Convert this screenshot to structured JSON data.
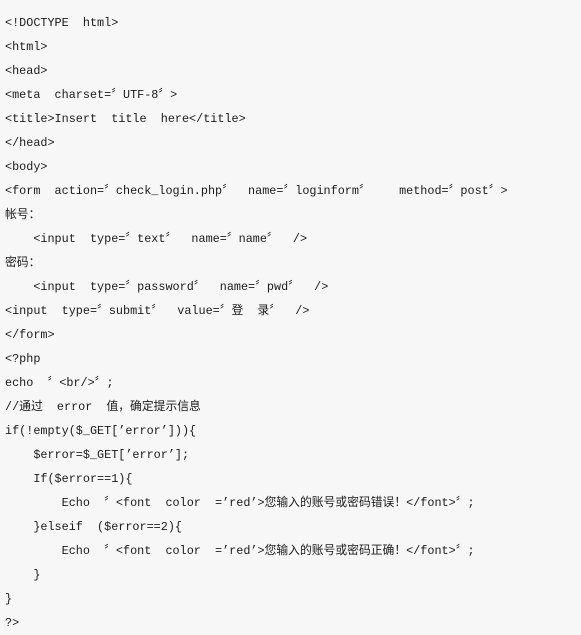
{
  "document": {
    "kind": "source-code-listing",
    "language": "php-html",
    "background_color": "#f7f7f7",
    "text_color": "#1a1a1a",
    "line_count": 24,
    "lines": [
      {
        "n": 1,
        "text": "<!DOCTYPE  html>"
      },
      {
        "n": 2,
        "text": "<html>"
      },
      {
        "n": 3,
        "text": "<head>"
      },
      {
        "n": 4,
        "text": "<meta  charset=〞UTF-8〞>"
      },
      {
        "n": 5,
        "text": "<title>Insert  title  here</title>"
      },
      {
        "n": 6,
        "text": "</head>"
      },
      {
        "n": 7,
        "text": "<body>"
      },
      {
        "n": 8,
        "text": "<form  action=〞check_login.php〞  name=〞loginform〞    method=〞post〞>"
      },
      {
        "n": 9,
        "text": "帐号："
      },
      {
        "n": 10,
        "text": "    <input  type=〞text〞  name=〞name〞  />"
      },
      {
        "n": 11,
        "text": "密码："
      },
      {
        "n": 12,
        "text": "    <input  type=〞password〞  name=〞pwd〞  />"
      },
      {
        "n": 13,
        "text": "<input  type=〞submit〞  value=〞登  录〞  />"
      },
      {
        "n": 14,
        "text": "</form>"
      },
      {
        "n": 15,
        "text": "<?php"
      },
      {
        "n": 16,
        "text": "echo  〞<br/>〞;"
      },
      {
        "n": 17,
        "text": "//通过  error  值，确定提示信息"
      },
      {
        "n": 18,
        "text": "if(!empty($_GET[’error’])){"
      },
      {
        "n": 19,
        "text": "    $error=$_GET[’error’];"
      },
      {
        "n": 20,
        "text": "    If($error==1){"
      },
      {
        "n": 21,
        "text": "        Echo  〞<font  color  =’red’>您输入的账号或密码错误！</font>〞;"
      },
      {
        "n": 22,
        "text": "    }elseif  ($error==2){"
      },
      {
        "n": 23,
        "text": "        Echo  〞<font  color  =’red’>您输入的账号或密码正确！</font>〞;"
      },
      {
        "n": 24,
        "text": "    }"
      },
      {
        "n": 25,
        "text": "}"
      },
      {
        "n": 26,
        "text": "?>"
      }
    ]
  }
}
